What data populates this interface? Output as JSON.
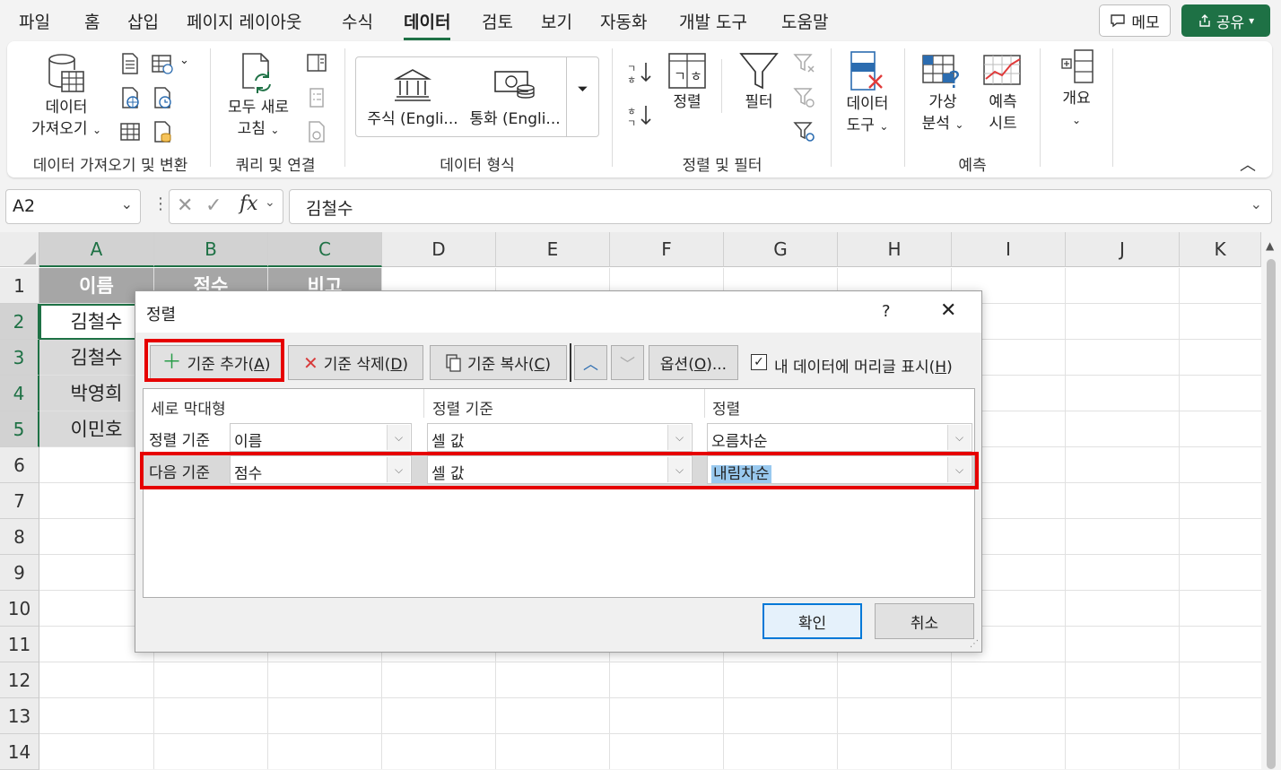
{
  "menu": {
    "tabs": [
      "파일",
      "홈",
      "삽입",
      "페이지 레이아웃",
      "수식",
      "데이터",
      "검토",
      "보기",
      "자동화",
      "개발 도구",
      "도움말"
    ],
    "active_tab": "데이터",
    "memo_label": "메모",
    "share_label": "공유",
    "share_color": "#1e7145"
  },
  "ribbon": {
    "get_data_line1": "데이터",
    "get_data_line2": "가져오기",
    "refresh_line1": "모두 새로",
    "refresh_line2": "고침",
    "stocks_label": "주식 (Engli...",
    "currency_label": "통화 (Engli...",
    "sort_label": "정렬",
    "filter_label": "필터",
    "data_tools_line1": "데이터",
    "data_tools_line2": "도구",
    "whatif_line1": "가상",
    "whatif_line2": "분석",
    "forecast_line1": "예측",
    "forecast_line2": "시트",
    "outline_label": "개요",
    "groups": {
      "get_transform": "데이터 가져오기 및 변환",
      "queries": "쿼리 및 연결",
      "data_types": "데이터 형식",
      "sort_filter": "정렬 및 필터",
      "forecast": "예측"
    }
  },
  "formula_bar": {
    "name_box": "A2",
    "formula": "김철수"
  },
  "sheet": {
    "columns": [
      "A",
      "B",
      "C",
      "D",
      "E",
      "F",
      "G",
      "H",
      "I",
      "J",
      "K"
    ],
    "rows": [
      "1",
      "2",
      "3",
      "4",
      "5",
      "6",
      "7",
      "8",
      "9",
      "10",
      "11",
      "12",
      "13",
      "14"
    ],
    "header_row": [
      "이름",
      "점수",
      "비고"
    ],
    "a_values": [
      "김철수",
      "김철수",
      "박영희",
      "이민호"
    ],
    "header_fill": "#a6a6a6",
    "data_fill": "#d9d9d9"
  },
  "dialog": {
    "title": "정렬",
    "help": "?",
    "add_level": "기준 추가",
    "add_level_key": "A",
    "delete_level": "기준 삭제",
    "delete_level_key": "D",
    "copy_level": "기준 복사",
    "copy_level_key": "C",
    "options": "옵션",
    "options_key": "O",
    "options_suffix": "...",
    "header_checkbox": "내 데이터에 머리글 표시",
    "header_checkbox_key": "H",
    "header_checked": true,
    "col_headers": [
      "세로 막대형",
      "정렬 기준",
      "정렬"
    ],
    "levels": [
      {
        "label": "정렬 기준",
        "column": "이름",
        "sort_on": "셀 값",
        "order": "오름차순"
      },
      {
        "label": "다음 기준",
        "column": "점수",
        "sort_on": "셀 값",
        "order": "내림차순"
      }
    ],
    "ok": "확인",
    "cancel": "취소",
    "highlight_color": "#e60000"
  }
}
